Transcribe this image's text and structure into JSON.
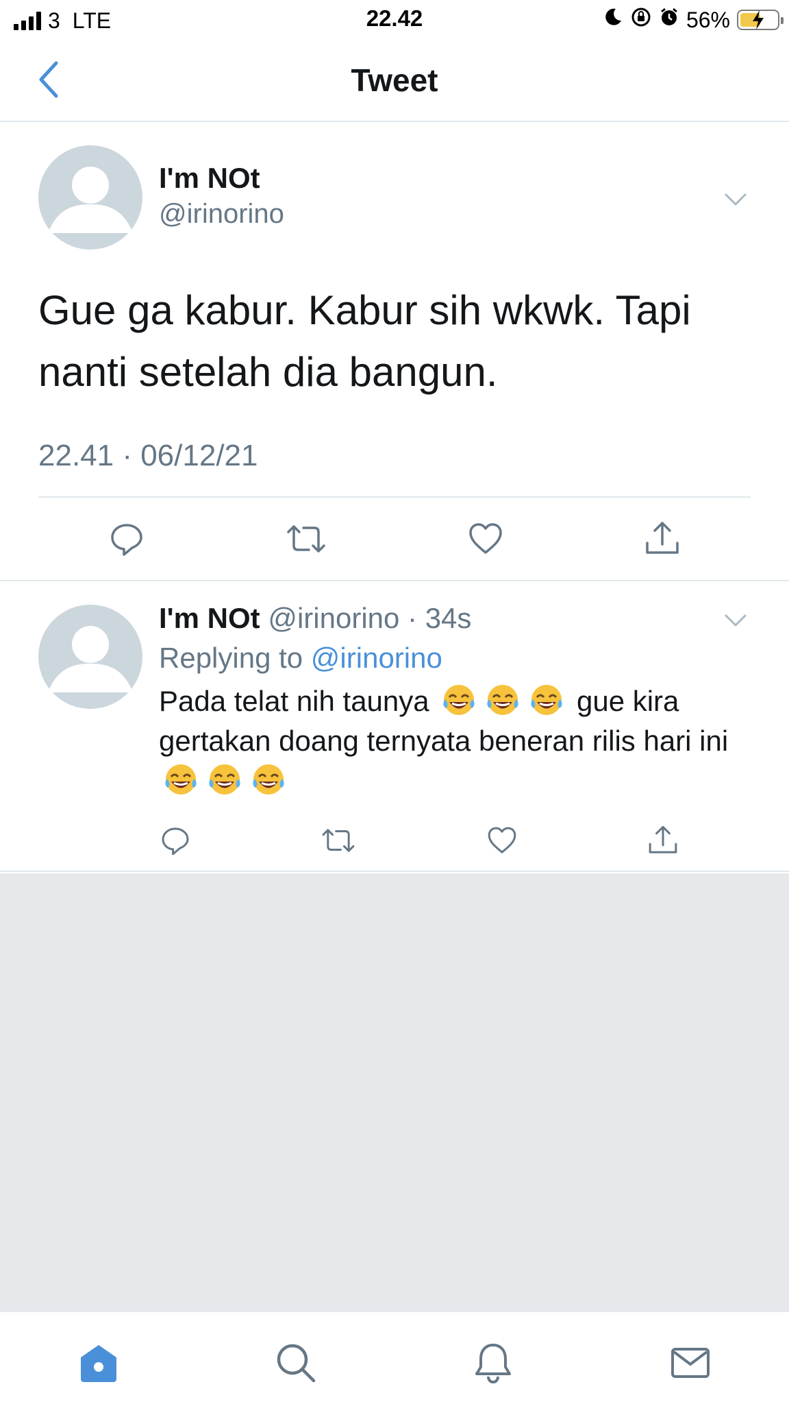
{
  "status_bar": {
    "carrier": "3",
    "network": "LTE",
    "time": "22.42",
    "battery_percent": "56%",
    "battery_level": 0.56,
    "icons": [
      "signal-icon",
      "moon-icon",
      "rotation-lock-icon",
      "alarm-icon",
      "battery-charging-icon"
    ]
  },
  "nav": {
    "title": "Tweet",
    "back_icon": "chevron-left-icon"
  },
  "main_tweet": {
    "name": "I'm NOt",
    "handle": "@irinorino",
    "text": "Gue ga kabur. Kabur sih wkwk. Tapi nanti setelah dia bangun.",
    "timestamp": "22.41 · 06/12/21",
    "actions": [
      "reply-icon",
      "retweet-icon",
      "like-icon",
      "share-icon"
    ]
  },
  "reply": {
    "name": "I'm NOt",
    "handle_time": "@irinorino · 34s",
    "replying_label": "Replying to",
    "replying_mention": "@irinorino",
    "text_part1": "Pada telat nih taunya",
    "text_part2": "gue kira gertakan doang ternyata beneran rilis hari ini",
    "emoji": "face-with-tears-of-joy-emoji",
    "actions": [
      "reply-icon",
      "retweet-icon",
      "like-icon",
      "share-icon"
    ]
  },
  "tab_bar": {
    "tabs": [
      "home-icon",
      "search-icon",
      "notifications-icon",
      "messages-icon"
    ],
    "active": "home-icon"
  },
  "colors": {
    "accent": "#4a90d9",
    "secondary_text": "#657786",
    "divider": "#e1e8ed",
    "empty_background": "#e6e8ec",
    "avatar_placeholder": "#ccd6dd"
  }
}
